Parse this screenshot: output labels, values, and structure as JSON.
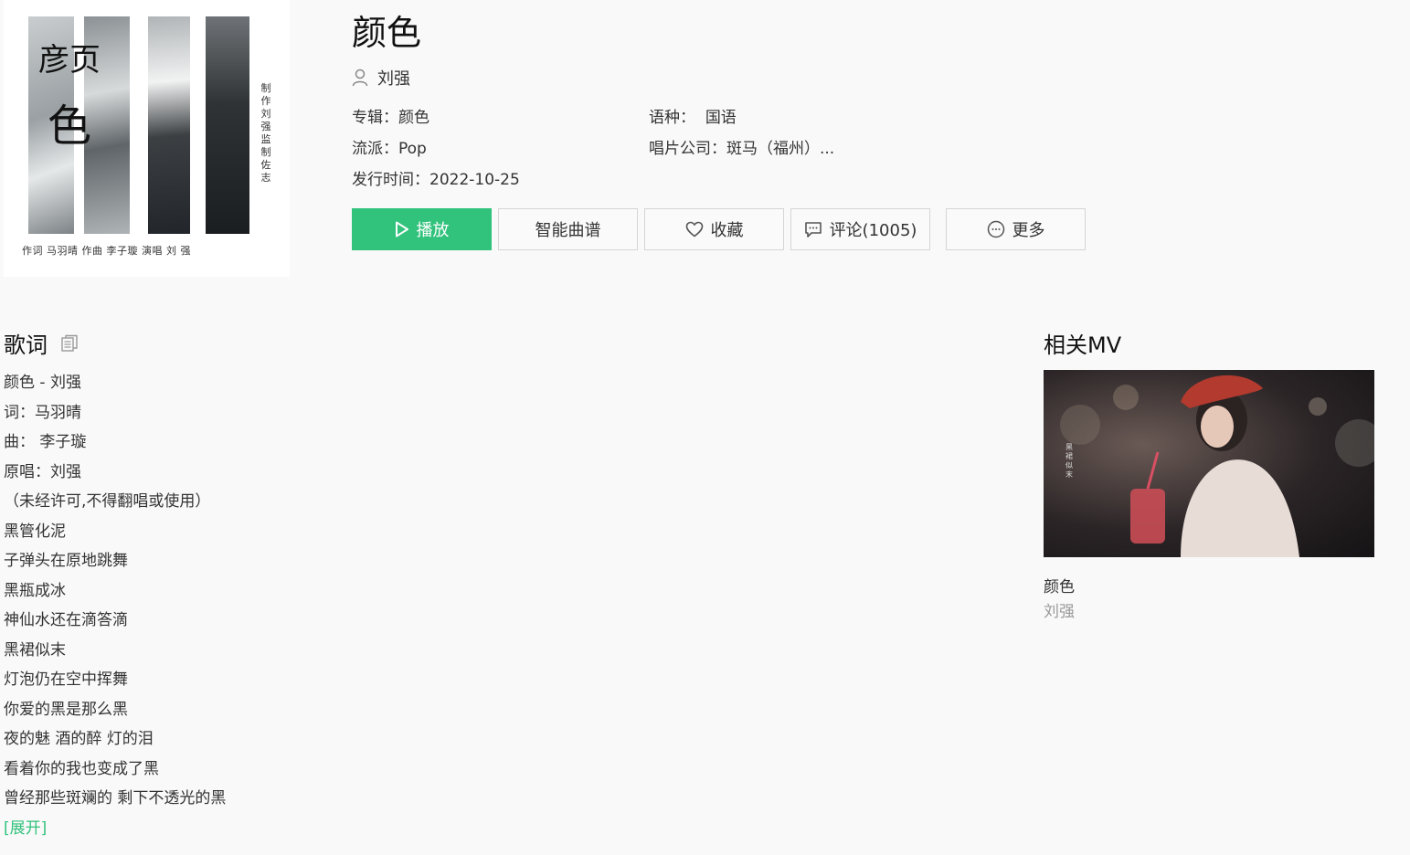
{
  "cover": {
    "title_top": "彦页",
    "title_bottom": "色",
    "side_text": "制作刘强监制佐志",
    "credits": "作词  马羽晴    作曲  李子璇     演唱   刘 强"
  },
  "song": {
    "title": "颜色",
    "artist": "刘强",
    "album_label": "专辑：",
    "album": "颜色",
    "language_label": "语种：",
    "language": "国语",
    "genre_label": "流派：",
    "genre": "Pop",
    "label_label": "唱片公司：",
    "label": "斑马（福州）...",
    "release_label": "发行时间：",
    "release_date": "2022-10-25"
  },
  "actions": {
    "play": "播放",
    "sheet": "智能曲谱",
    "favorite": "收藏",
    "comment": "评论(1005)",
    "more": "更多"
  },
  "lyrics": {
    "title": "歌词",
    "lines": [
      "颜色 - 刘强",
      "词：马羽晴",
      "曲：  李子璇",
      "原唱：刘强",
      "（未经许可,不得翻唱或使用）",
      "黑管化泥",
      "子弹头在原地跳舞",
      "黑瓶成冰",
      "神仙水还在滴答滴",
      "黑裙似末",
      "灯泡仍在空中挥舞",
      "你爱的黑是那么黑",
      "夜的魅 酒的醉 灯的泪",
      "看着你的我也变成了黑",
      "曾经那些斑斓的 剩下不透光的黑"
    ],
    "expand": "[展开]"
  },
  "mv": {
    "section_title": "相关MV",
    "thumb_caption": "黑裙似末",
    "title": "颜色",
    "artist": "刘强"
  },
  "colors": {
    "accent": "#31c27c",
    "background": "#f9f9f9"
  }
}
